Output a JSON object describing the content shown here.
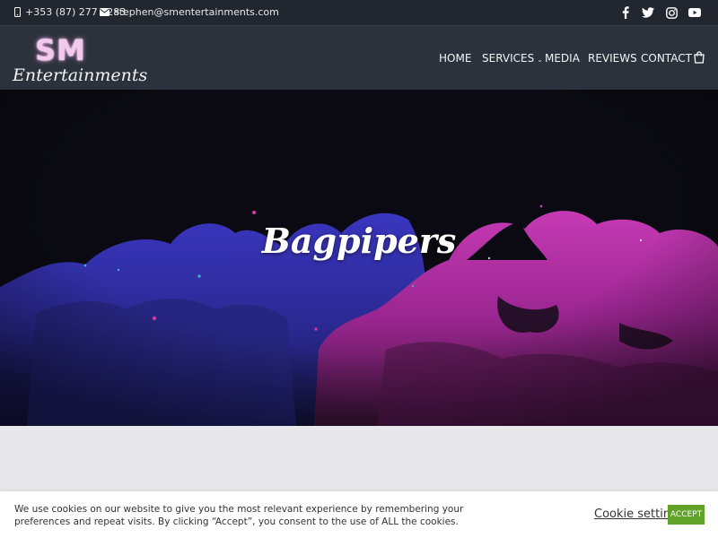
{
  "topbar": {
    "phone": "+353 (87) 277 3283",
    "email": "stephen@smentertainments.com",
    "phone_icon": "mobile-phone-icon",
    "email_icon": "envelope-icon",
    "social_icons": [
      "facebook-icon",
      "twitter-icon",
      "instagram-icon",
      "youtube-icon"
    ]
  },
  "logo": {
    "mark": "SM",
    "wordmark": "Entertainments"
  },
  "nav": {
    "items": [
      {
        "label": "HOME"
      },
      {
        "label": "SERVICES",
        "icon": "chevron-down-icon"
      },
      {
        "label": "MEDIA"
      },
      {
        "label": "REVIEWS"
      },
      {
        "label": "CONTACT"
      }
    ],
    "cart_icon": "shopping-bag-icon"
  },
  "hero": {
    "title": "Bagpipers"
  },
  "cookie": {
    "text": "We use cookies on our website to give you the most relevant experience by remembering your preferences and repeat visits. By clicking “Accept”, you consent to the use of ALL the cookies.",
    "settings_label": "Cookie settings",
    "accept_label": "ACCEPT"
  },
  "colors": {
    "topbar_bg": "#22272f",
    "navbar_bg": "#2c323c",
    "accent_pink": "#f4c9ee",
    "cloud_blue": "#2b2a9c",
    "cloud_magenta": "#a0278f",
    "accept_green": "#61a229"
  }
}
